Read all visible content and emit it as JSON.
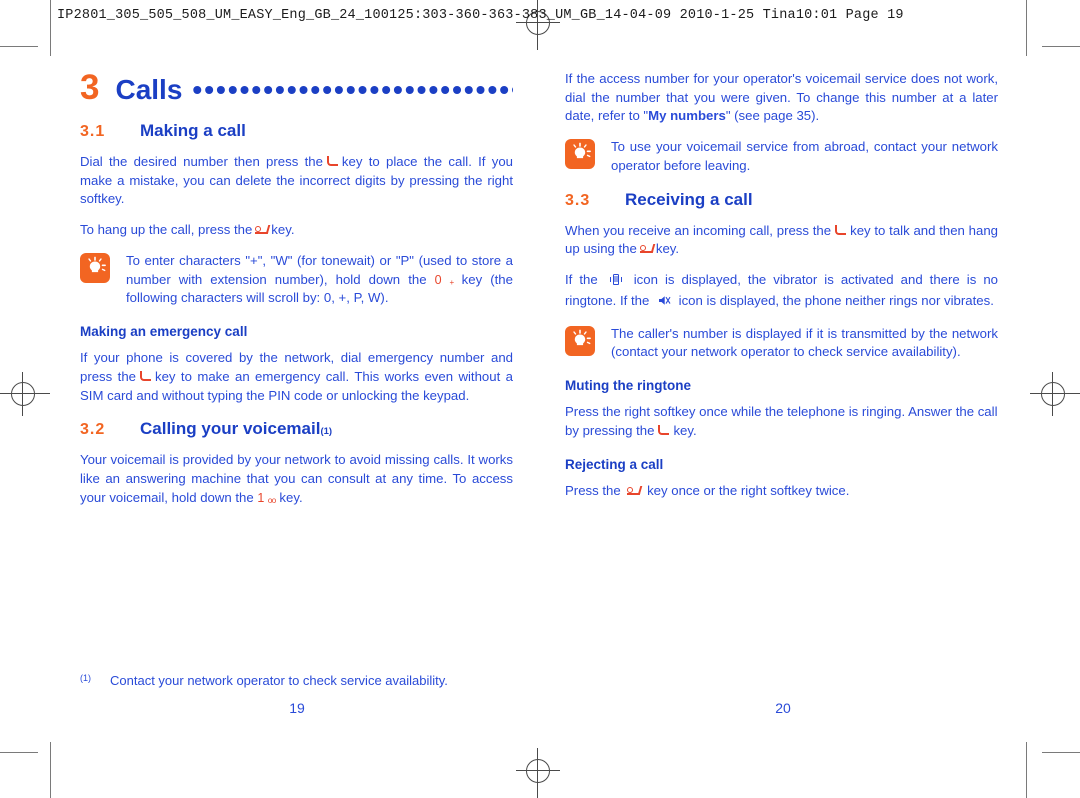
{
  "prepress": {
    "header": "IP2801_305_505_508_UM_EASY_Eng_GB_24_100125:303-360-363-383_UM_GB_14-04-09  2010-1-25  Tina10:01  Page 19"
  },
  "colors": {
    "orange": "#F26522",
    "blue": "#1B3FC4",
    "body_blue": "#2A4BD8",
    "key_red": "#E8452B"
  },
  "chapter": {
    "number": "3",
    "name": "Calls",
    "dots": "•••••••••••••••••••••••••••••"
  },
  "left_column": {
    "section_3_1": {
      "number": "3.1",
      "title": "Making a call"
    },
    "para_dial_a": "Dial the desired number then press the",
    "para_dial_b": "key to place the call. If you make a mistake, you can delete the incorrect digits by pressing the right softkey.",
    "para_hangup_a": "To hang up the call, press the",
    "para_hangup_b": "key.",
    "tip_enter_chars_a": "To enter characters \"+\", \"W\" (for tonewait) or \"P\" (used to store a number with extension number), hold down the",
    "tip_key_0": "0",
    "tip_key_0_sub": "+",
    "tip_enter_chars_b": "key (the following characters will scroll by: 0, +, P, W).",
    "sub_emergency": "Making an emergency call",
    "para_emergency_a": "If your phone is covered by the network, dial emergency number and press the",
    "para_emergency_b": "key to make an emergency call. This works even without a SIM card and without typing the PIN code or unlocking the keypad.",
    "section_3_2": {
      "number": "3.2",
      "title": "Calling your voicemail",
      "footnote_marker": "(1)"
    },
    "para_voicemail_a": "Your voicemail is provided by your network to avoid missing calls. It works like an answering machine that you can consult at any time. To access your voicemail, hold down the",
    "para_voicemail_key": "1",
    "para_voicemail_key_sub": "oo",
    "para_voicemail_b": "key."
  },
  "right_column": {
    "para_access_a": "If the access number for your operator's voicemail service does not work, dial the number that you were given. To change this number at a later date, refer to \"",
    "para_access_bold": "My numbers",
    "para_access_b": "\" (see page 35).",
    "tip_abroad": "To use your voicemail service from abroad, contact your network operator before leaving.",
    "section_3_3": {
      "number": "3.3",
      "title": "Receiving a call"
    },
    "para_incoming_a": "When you receive an incoming call, press the",
    "para_incoming_b": "key to talk and then hang up using the",
    "para_incoming_c": "key.",
    "para_vibrate_a": "If the",
    "para_vibrate_b": "icon is displayed, the vibrator is activated and there is no ringtone. If the",
    "para_vibrate_c": "icon is displayed, the phone neither rings nor vibrates.",
    "tip_caller_number": "The caller's number is displayed if it is transmitted by the network (contact your network operator to check service availability).",
    "sub_muting": "Muting the ringtone",
    "para_muting_a": "Press the right softkey once while the telephone is ringing. Answer the call by pressing the",
    "para_muting_b": "key.",
    "sub_rejecting": "Rejecting a call",
    "para_rejecting_a": "Press the",
    "para_rejecting_b": "key once or the right softkey twice."
  },
  "footnote": {
    "marker": "(1)",
    "text": "Contact your network operator to check service availability."
  },
  "folio": {
    "left": "19",
    "right": "20"
  },
  "icons": {
    "tip": "lightbulb-icon",
    "send_key": "call-send-key-icon",
    "end_key": "call-end-key-icon",
    "vibrate": "vibrate-icon",
    "silent": "silent-mode-icon",
    "registration": "registration-mark-icon"
  }
}
